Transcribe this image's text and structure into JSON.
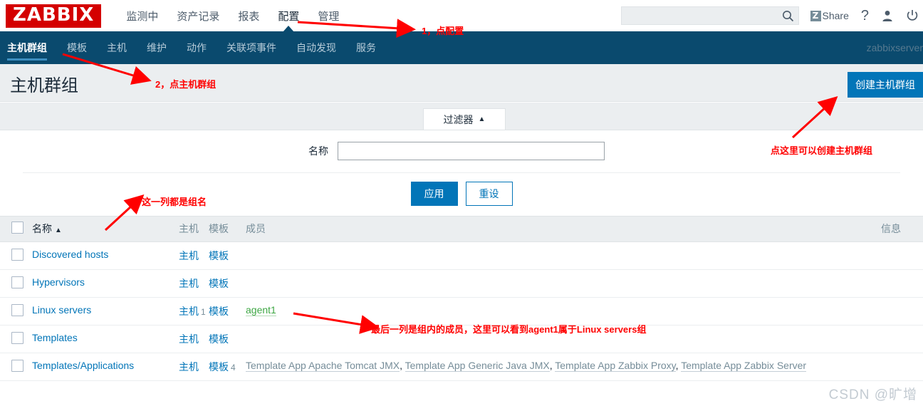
{
  "header": {
    "logo": "ZABBIX",
    "main_menu": [
      {
        "label": "监测中",
        "active": false
      },
      {
        "label": "资产记录",
        "active": false
      },
      {
        "label": "报表",
        "active": false
      },
      {
        "label": "配置",
        "active": true
      },
      {
        "label": "管理",
        "active": false
      }
    ],
    "search": {
      "value": "",
      "placeholder": ""
    },
    "share_label": "Share",
    "share_mark": "Z",
    "help_icon": "?",
    "icons": [
      "search-icon",
      "share-icon",
      "help-icon",
      "user-icon",
      "power-icon"
    ]
  },
  "subnav": {
    "items": [
      {
        "label": "主机群组",
        "active": true
      },
      {
        "label": "模板",
        "active": false
      },
      {
        "label": "主机",
        "active": false
      },
      {
        "label": "维护",
        "active": false
      },
      {
        "label": "动作",
        "active": false
      },
      {
        "label": "关联项事件",
        "active": false
      },
      {
        "label": "自动发现",
        "active": false
      },
      {
        "label": "服务",
        "active": false
      }
    ],
    "server_name": "zabbixserver"
  },
  "page": {
    "title": "主机群组",
    "create_button": "创建主机群组"
  },
  "filter": {
    "tab_label": "过滤器",
    "tab_arrow": "▲",
    "name_label": "名称",
    "name_value": "",
    "name_placeholder": "",
    "apply_button": "应用",
    "reset_button": "重设"
  },
  "table": {
    "columns": {
      "name": "名称",
      "sort_arrow": "▲",
      "hosts": "主机",
      "templates": "模板",
      "members": "成员",
      "info": "信息"
    },
    "rows": [
      {
        "name": "Discovered hosts",
        "hosts_label": "主机",
        "hosts_count": "",
        "templates_label": "模板",
        "templates_count": "",
        "members": []
      },
      {
        "name": "Hypervisors",
        "hosts_label": "主机",
        "hosts_count": "",
        "templates_label": "模板",
        "templates_count": "",
        "members": []
      },
      {
        "name": "Linux servers",
        "hosts_label": "主机",
        "hosts_count": "1",
        "templates_label": "模板",
        "templates_count": "",
        "members": [
          {
            "text": "agent1",
            "color": "green"
          }
        ]
      },
      {
        "name": "Templates",
        "hosts_label": "主机",
        "hosts_count": "",
        "templates_label": "模板",
        "templates_count": "",
        "members": []
      },
      {
        "name": "Templates/Applications",
        "hosts_label": "主机",
        "hosts_count": "",
        "templates_label": "模板",
        "templates_count": "4",
        "members": [
          {
            "text": "Template App Apache Tomcat JMX",
            "color": "grey"
          },
          {
            "text": "Template App Generic Java JMX",
            "color": "grey"
          },
          {
            "text": "Template App Zabbix Proxy",
            "color": "grey"
          },
          {
            "text": "Template App Zabbix Server",
            "color": "grey"
          }
        ]
      }
    ]
  },
  "annotations": [
    {
      "id": "a1",
      "text": "1，点配置"
    },
    {
      "id": "a2",
      "text": "2，点主机群组"
    },
    {
      "id": "a3",
      "text": "点这里可以创建主机群组"
    },
    {
      "id": "a4",
      "text": "这一列都是组名"
    },
    {
      "id": "a5",
      "text": "最后一列是组内的成员，这里可以看到agent1属于Linux servers组"
    }
  ],
  "watermark": "CSDN @旷增",
  "colors": {
    "brand_red": "#d40000",
    "nav_blue": "#0a4a6e",
    "accent_blue": "#0275b8",
    "link_blue": "#0275b8",
    "annotation_red": "#ff0000",
    "member_green": "#3ea744"
  }
}
